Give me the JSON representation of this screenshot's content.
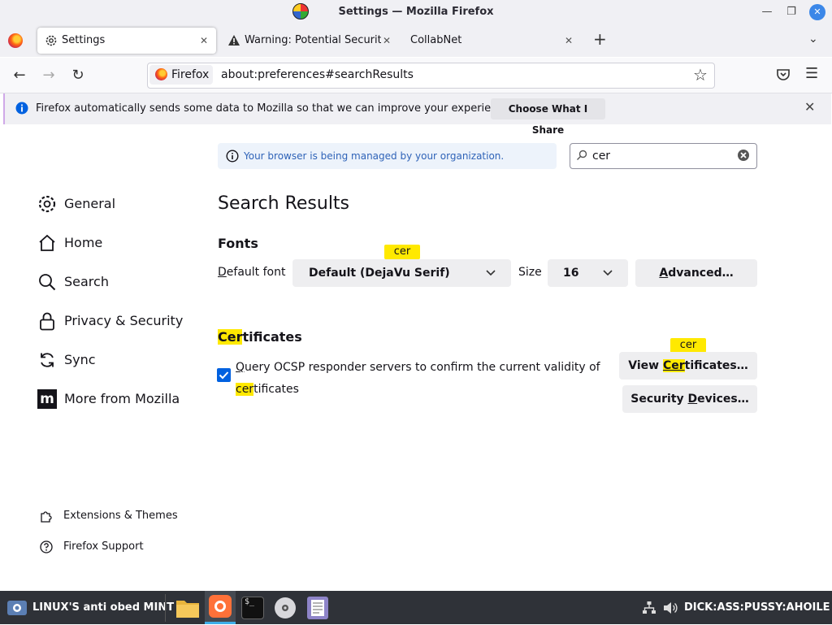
{
  "window": {
    "title": "Settings — Mozilla Firefox"
  },
  "tabs": [
    {
      "label": "Settings"
    },
    {
      "label": "Warning: Potential Security"
    },
    {
      "label": "CollabNet"
    }
  ],
  "tab_close": "✕",
  "new_tab": "+",
  "identity_label": "Firefox",
  "url": "about:preferences#searchResults",
  "notification": {
    "text": "Firefox automatically sends some data to Mozilla so that we can improve your experience.",
    "button": "Choose What I Share"
  },
  "managed_text": "Your browser is being managed by your organization.",
  "search": {
    "value": "cer"
  },
  "sidebar": {
    "items": [
      {
        "label": "General"
      },
      {
        "label": "Home"
      },
      {
        "label": "Search"
      },
      {
        "label": "Privacy & Security"
      },
      {
        "label": "Sync"
      },
      {
        "label": "More from Mozilla"
      }
    ],
    "footer": [
      {
        "label": "Extensions & Themes"
      },
      {
        "label": "Firefox Support"
      }
    ]
  },
  "main": {
    "heading": "Search Results",
    "fonts": {
      "title": "Fonts",
      "default_label_u": "D",
      "default_label_rest": "efault font",
      "default_value": "Default (DejaVu Serif)",
      "size_label": "Size",
      "size_value": "16",
      "advanced_u": "A",
      "advanced_rest": "dvanced…",
      "tooltip": "cer"
    },
    "certificates": {
      "title_hl": "Cer",
      "title_rest": "tificates",
      "checkbox_checked": true,
      "checkbox_u": "Q",
      "checkbox_text1": "uery OCSP responder servers to confirm the current validity of",
      "checkbox_hl": "cer",
      "checkbox_text2": "tificates",
      "view_pre": "View ",
      "view_hl": "Cer",
      "view_rest": "tificates…",
      "devices_pre": "Security ",
      "devices_u": "D",
      "devices_rest": "evices…",
      "tooltip": "cer"
    }
  },
  "taskbar": {
    "start_label": "LINUX'S anti obed MINT",
    "tray_text": "DICK:ASS:PUSSY:AHOILE"
  },
  "colors": {
    "accent": "#0061e0",
    "highlight": "#ffe900",
    "taskbar": "#2f3238"
  }
}
